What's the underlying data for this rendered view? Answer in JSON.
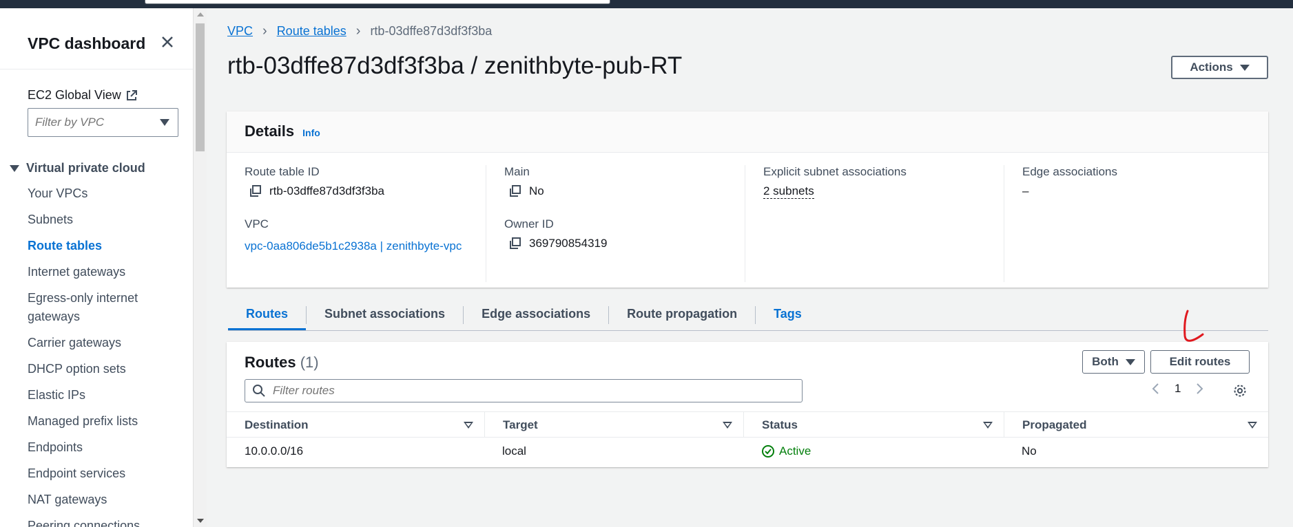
{
  "sidebar": {
    "title": "VPC dashboard",
    "global_view": "EC2 Global View",
    "filter_placeholder": "Filter by VPC",
    "section": "Virtual private cloud",
    "items": [
      {
        "label": "Your VPCs"
      },
      {
        "label": "Subnets"
      },
      {
        "label": "Route tables",
        "active": true
      },
      {
        "label": "Internet gateways"
      },
      {
        "label": "Egress-only internet gateways"
      },
      {
        "label": "Carrier gateways"
      },
      {
        "label": "DHCP option sets"
      },
      {
        "label": "Elastic IPs"
      },
      {
        "label": "Managed prefix lists"
      },
      {
        "label": "Endpoints"
      },
      {
        "label": "Endpoint services"
      },
      {
        "label": "NAT gateways"
      },
      {
        "label": "Peering connections"
      }
    ]
  },
  "breadcrumb": {
    "vpc": "VPC",
    "route_tables": "Route tables",
    "current": "rtb-03dffe87d3df3f3ba"
  },
  "page": {
    "title": "rtb-03dffe87d3df3f3ba / zenithbyte-pub-RT",
    "actions_label": "Actions"
  },
  "details": {
    "heading": "Details",
    "info": "Info",
    "route_table_id_label": "Route table ID",
    "route_table_id": "rtb-03dffe87d3df3f3ba",
    "main_label": "Main",
    "main_value": "No",
    "explicit_label": "Explicit subnet associations",
    "explicit_value": "2 subnets",
    "edge_label": "Edge associations",
    "edge_value": "–",
    "vpc_label": "VPC",
    "vpc_value": "vpc-0aa806de5b1c2938a | zenithbyte-vpc",
    "owner_label": "Owner ID",
    "owner_value": "369790854319"
  },
  "tabs": [
    {
      "label": "Routes"
    },
    {
      "label": "Subnet associations"
    },
    {
      "label": "Edge associations"
    },
    {
      "label": "Route propagation"
    },
    {
      "label": "Tags"
    }
  ],
  "routes": {
    "heading": "Routes",
    "count": "(1)",
    "both_label": "Both",
    "edit_label": "Edit routes",
    "filter_placeholder": "Filter routes",
    "page": "1",
    "columns": [
      "Destination",
      "Target",
      "Status",
      "Propagated"
    ],
    "rows": [
      {
        "destination": "10.0.0.0/16",
        "target": "local",
        "status": "Active",
        "propagated": "No"
      }
    ]
  },
  "colors": {
    "link": "#0972d3",
    "success": "#037f0c",
    "topbar": "#232f3e",
    "annotation": "#e0191f"
  }
}
